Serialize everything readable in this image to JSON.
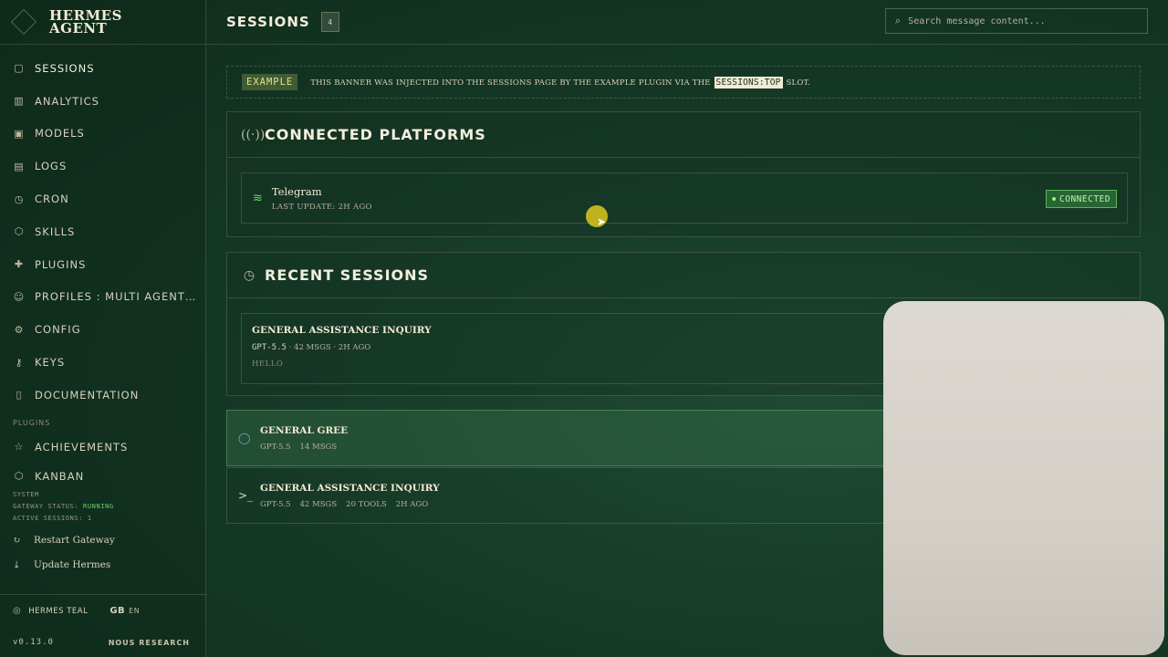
{
  "app": {
    "title_line1": "HERMES",
    "title_line2": "AGENT"
  },
  "sidebar": {
    "items": [
      {
        "label": "SESSIONS",
        "icon": "chat-icon",
        "active": true
      },
      {
        "label": "ANALYTICS",
        "icon": "bar-chart-icon"
      },
      {
        "label": "MODELS",
        "icon": "cpu-icon"
      },
      {
        "label": "LOGS",
        "icon": "file-icon"
      },
      {
        "label": "CRON",
        "icon": "clock-icon"
      },
      {
        "label": "SKILLS",
        "icon": "package-icon"
      },
      {
        "label": "PLUGINS",
        "icon": "puzzle-icon"
      },
      {
        "label": "PROFILES : MULTI AGENT…",
        "icon": "users-icon"
      },
      {
        "label": "CONFIG",
        "icon": "gear-icon"
      },
      {
        "label": "KEYS",
        "icon": "key-icon"
      },
      {
        "label": "DOCUMENTATION",
        "icon": "book-icon"
      }
    ],
    "plugins_label": "PLUGINS",
    "plugin_items": [
      {
        "label": "ACHIEVEMENTS",
        "icon": "star-icon"
      },
      {
        "label": "KANBAN",
        "icon": "kanban-icon"
      }
    ],
    "system_label": "SYSTEM",
    "gateway_status_label": "GATEWAY STATUS:",
    "gateway_status_value": "RUNNING",
    "active_sessions": "ACTIVE SESSIONS: 1",
    "restart_label": "Restart Gateway",
    "update_label": "Update Hermes",
    "theme_label": "HERMES TEAL",
    "lang_code": "GB",
    "lang_label": "EN",
    "version": "v0.13.0",
    "vendor": "NOUS RESEARCH"
  },
  "header": {
    "title": "SESSIONS",
    "count": "4",
    "search_placeholder": "Search message content..."
  },
  "banner": {
    "tag": "EXAMPLE",
    "text_before": "THIS BANNER WAS INJECTED INTO THE SESSIONS PAGE BY THE EXAMPLE PLUGIN VIA THE",
    "code": "SESSIONS:TOP",
    "text_after": "SLOT."
  },
  "platforms": {
    "heading": "CONNECTED PLATFORMS",
    "items": [
      {
        "name": "Telegram",
        "meta": "LAST UPDATE: 2H AGO",
        "status": "CONNECTED"
      }
    ]
  },
  "recent": {
    "heading": "RECENT SESSIONS",
    "card": {
      "title": "GENERAL ASSISTANCE INQUIRY",
      "model": "GPT-5.5",
      "meta": "· 42 MSGS · 2H AGO",
      "preview": "HELLO"
    }
  },
  "sessions": [
    {
      "title": "GENERAL GREE",
      "model": "GPT-5.5",
      "msgs": "14 MSGS",
      "tools": "",
      "time": ""
    },
    {
      "title": "GENERAL ASSISTANCE INQUIRY",
      "model": "GPT-5.5",
      "msgs": "42 MSGS",
      "tools": "20 TOOLS",
      "time": "2H AGO"
    }
  ],
  "colors": {
    "accent_green": "#6fcf6a",
    "background": "#163a27",
    "text": "#e8e2cf"
  }
}
